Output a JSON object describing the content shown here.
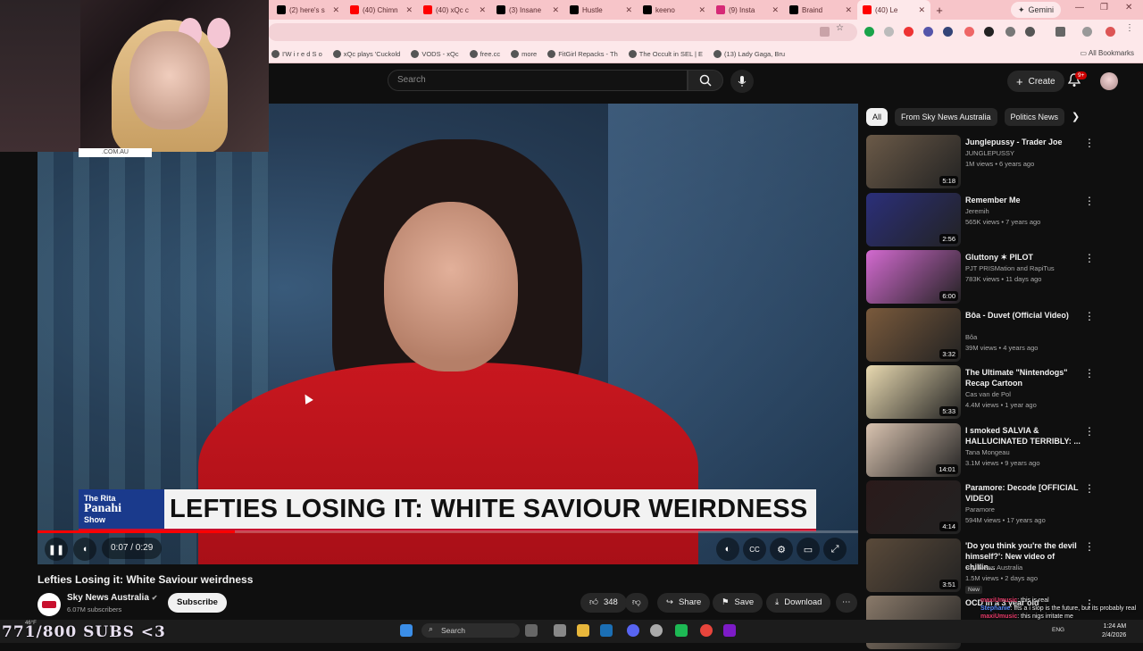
{
  "browser": {
    "tabs": [
      {
        "label": "(2) here's s",
        "color": "#000000"
      },
      {
        "label": "(40) Chimn",
        "color": "#ff0000"
      },
      {
        "label": "(40) xQc c",
        "color": "#ff0000"
      },
      {
        "label": "(3) Insane",
        "color": "#000000"
      },
      {
        "label": "Hustle",
        "color": "#000000"
      },
      {
        "label": "keeno",
        "color": "#000000"
      },
      {
        "label": "(9) Insta",
        "color": "#d62976"
      },
      {
        "label": "Braind",
        "color": "#000000"
      },
      {
        "label": "(40) Le",
        "color": "#ff0000"
      }
    ],
    "gemini_label": "Gemini",
    "bookmarks": [
      "I'W i r e d   S o",
      "xQc plays 'Cuckold",
      "VODS - xQc",
      "free.cc",
      "more",
      "FitGirl Repacks - Th",
      "The Occult in SEL | E",
      "(13) Lady Gaga, Bru"
    ],
    "all_bookmarks_label": "All Bookmarks"
  },
  "youtube_header": {
    "search_placeholder": "Search",
    "create_label": "Create",
    "notification_count": "9+"
  },
  "webcam_tag": ".COM.AU",
  "player": {
    "show_logo_line1": "The Rita",
    "show_logo_line2": "Panahi",
    "show_logo_line3": "Show",
    "headline": "LEFTIES LOSING IT: WHITE SAVIOUR WEIRDNESS",
    "time": "0:07 / 0:29",
    "progress": 0.241
  },
  "video": {
    "title": "Lefties Losing it: White Saviour weirdness",
    "channel": "Sky News Australia",
    "subscribers": "6.07M subscribers",
    "subscribe_label": "Subscribe",
    "likes": "348",
    "share_label": "Share",
    "save_label": "Save",
    "download_label": "Download"
  },
  "sidebar": {
    "chips": [
      "All",
      "From Sky News Australia",
      "Politics News"
    ],
    "recommendations": [
      {
        "title": "Junglepussy - Trader Joe",
        "channel": "JUNGLEPUSSY",
        "meta": "1M views • 6 years ago",
        "duration": "5:18",
        "thumb": "#6b5a48"
      },
      {
        "title": "Remember Me",
        "channel": "Jeremih",
        "meta": "565K views • 7 years ago",
        "duration": "2:56",
        "thumb": "#2b2f7a"
      },
      {
        "title": "Gluttony ✶ PILOT",
        "channel": "PJT PRISMation and RapiTus",
        "meta": "783K views • 11 days ago",
        "duration": "6:00",
        "thumb": "#d36ad0"
      },
      {
        "title": "Bôa - Duvet (Official Video)",
        "channel": "Bôa",
        "meta": "39M views • 4 years ago",
        "duration": "3:32",
        "thumb": "#7a5a3c"
      },
      {
        "title": "The Ultimate \"Nintendogs\" Recap Cartoon",
        "channel": "Cas van de Pol",
        "meta": "4.4M views • 1 year ago",
        "duration": "5:33",
        "thumb": "#e8d9b0"
      },
      {
        "title": "I smoked SALVIA & HALLUCINATED TERRIBLY: ...",
        "channel": "Tana Mongeau",
        "meta": "3.1M views • 9 years ago",
        "duration": "14:01",
        "thumb": "#d9c3b0"
      },
      {
        "title": "Paramore: Decode [OFFICIAL VIDEO]",
        "channel": "Paramore",
        "meta": "594M views • 17 years ago",
        "duration": "4:14",
        "thumb": "#2a1a1a"
      },
      {
        "title": "'Do you think you're the devil himself?': New video of chillin...",
        "channel": "Sky News Australia",
        "meta": "1.5M views • 2 days ago",
        "duration": "3:51",
        "thumb": "#5a4a3a",
        "badge": "New"
      },
      {
        "title": "OCD in a 3 year old",
        "channel": "",
        "meta": "",
        "duration": "",
        "thumb": "#8a7a6a"
      }
    ]
  },
  "overlay": {
    "sub_goal": "771/800 SUBS <3",
    "chat_line1_user": "maxiUmusic",
    "chat_line1_text": "this is real",
    "chat_line2_user": "Stephanie",
    "chat_line2_text": "ffts a i slop is the future, but its probably real",
    "chat_line3_user": "maxiUmusic",
    "chat_line3_text": "this nigs irritate me"
  },
  "taskbar": {
    "search_label": "Search",
    "weather": "46°F",
    "time": "1:24 AM",
    "date": "2/4/2026",
    "lang": "ENG"
  }
}
